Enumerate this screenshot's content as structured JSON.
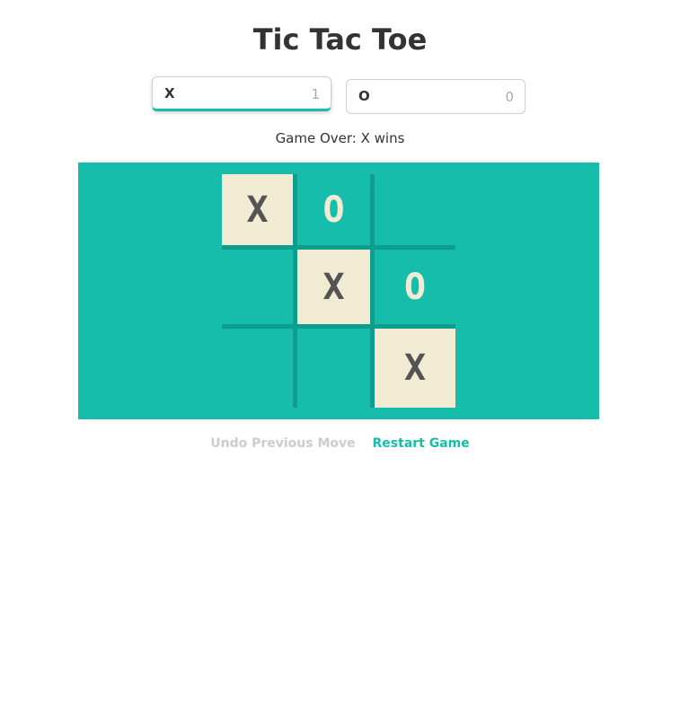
{
  "title": "Tic Tac Toe",
  "players": [
    {
      "symbol": "X",
      "score": "1",
      "active": true
    },
    {
      "symbol": "O",
      "score": "0",
      "active": false
    }
  ],
  "status": "Game Over: X wins",
  "board": [
    [
      "X",
      "O",
      ""
    ],
    [
      "",
      "X",
      "O"
    ],
    [
      "",
      "",
      "X"
    ]
  ],
  "winning_cells": [
    [
      0,
      0
    ],
    [
      1,
      1
    ],
    [
      2,
      2
    ]
  ],
  "actions": {
    "undo_label": "Undo Previous Move",
    "restart_label": "Restart Game"
  },
  "colors": {
    "board": "#16bdab",
    "grid_lines": "#0e9e8e",
    "x_mark": "#545454",
    "o_mark": "#f2ebd4",
    "win_cell": "#f2ebd4",
    "undo_disabled": "#cccccc",
    "restart": "#16bdab"
  }
}
